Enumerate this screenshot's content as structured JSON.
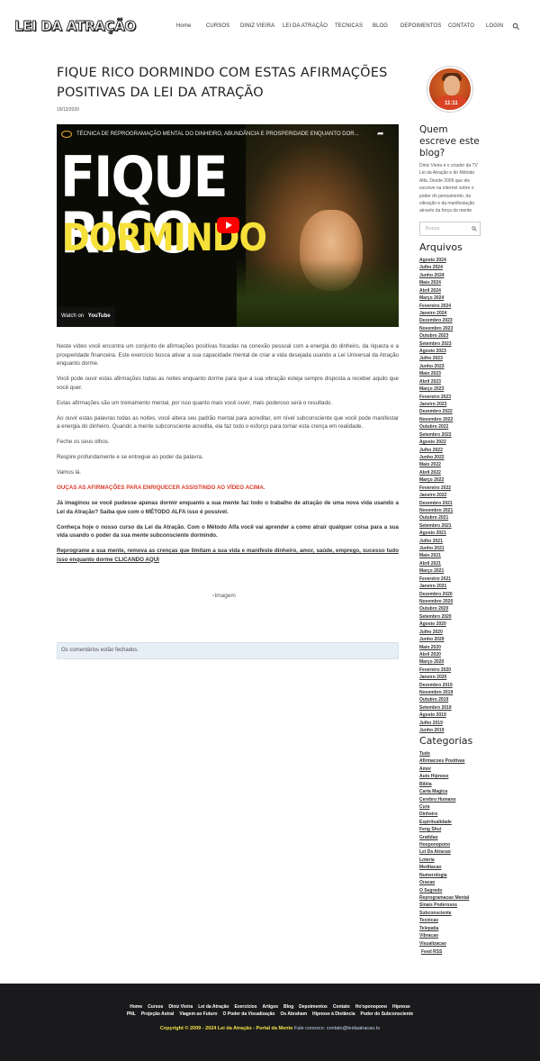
{
  "header": {
    "logo": "LEI DA ATRAÇÃO",
    "nav": [
      "Home",
      "CURSOS",
      "DINIZ VIEIRA",
      "LEI DA ATRAÇÃO",
      "TECNICAS",
      "BLOG",
      "DEPOIMENTOS",
      "CONTATO",
      "LOGIN"
    ]
  },
  "post": {
    "title_line1": "FIQUE RICO DORMINDO COM ESTAS AFIRMAÇÕES",
    "title_line2": "POSITIVAS DA LEI DA ATRAÇÃO",
    "date": "19/12/2020",
    "video": {
      "title": "TÉCNICA DE REPROGRAMAÇÃO MENTAL DO DINHEIRO, ABUNDÂNCIA E PROSPERIDADE ENQUANTO DOR...",
      "thumb_line1": "FIQUE RICO",
      "thumb_line2": "DORMINDO",
      "watch_on": "Watch on",
      "youtube": "YouTube"
    },
    "paragraphs": [
      "Neste vídeo você encontra um conjunto de afirmações positivas focadas na conexão pessoal com a energia do dinheiro, da riqueza e a prosperidade financeira. Este exercício busca ativar a sua capacidade mental de criar a vida desejada usando a Lei Universal da Atração enquanto dorme.",
      "Você pode ouvir estas afirmações todas as noites enquanto dorme para que a sua vibração esteja sempre disposta a receber aquilo que você quer.",
      "Estas afirmações são um treinamento mental, por isso quanto mais você ouvir, mais poderoso será o resultado.",
      "Ao ouvir estas palavras todas as noites, você altera seu padrão mental para acreditar, em nível subconsciente que você pode manifestar a energia do dinheiro. Quando a mente subconsciente acredita, ela faz todo o esforço para tornar esta crença em realidade.",
      "Feche os seus olhos.",
      "Respire profundamente e se entregue ao poder da palavra.",
      "Vamos lá."
    ],
    "red_line": "OUÇAS AS AFIRMAÇÕES PARA ENRIQUECER ASSISTINDO AO VÍDEO ACIMA.",
    "bold1": "Já imaginou se você pudesse apenas dormir enquanto a sua mente faz todo o trabalho de atração de uma nova vida usando a Lei da Atração? Saiba que com o MÉTODO ALFA isso é possível.",
    "bold2": "Conheça hoje o nosso curso da Lei da Atração. Com o Método Alfa você vai aprender a como atrair qualquer coisa para a sua vida usando o poder da sua mente subconsciente dormindo.",
    "link": "Reprograme a sua mente, remova as crenças que limitam a sua vida e manifeste dinheiro, amor, saúde, emprego, sucesso tudo isso enquanto dorme CLICANDO AQUI",
    "image_alt": "Imagem",
    "comments_closed": "Os comentários estão fechados."
  },
  "sidebar": {
    "avatar_text": "11:11",
    "about_title": "Quem escreve este blog?",
    "about_text": "Diniz Vieira é o criador da TV Lei da Atração e do Método Alfa. Desde 2009 que ele escreve na internet sobre o poder do pensamento, da vibração e da manifestação através da força da mente.",
    "search_placeholder": "Busca",
    "archives_title": "Arquivos",
    "archives": [
      "Agosto 2024",
      "Julho 2024",
      "Junho 2024",
      "Maio 2024",
      "Abril 2024",
      "Março 2024",
      "Fevereiro 2024",
      "Janeiro 2024",
      "Dezembro 2023",
      "Novembro 2023",
      "Outubro 2023",
      "Setembro 2023",
      "Agosto 2023",
      "Julho 2023",
      "Junho 2023",
      "Maio 2023",
      "Abril 2023",
      "Março 2023",
      "Fevereiro 2023",
      "Janeiro 2023",
      "Dezembro 2022",
      "Novembro 2022",
      "Outubro 2022",
      "Setembro 2022",
      "Agosto 2022",
      "Julho 2022",
      "Junho 2022",
      "Maio 2022",
      "Abril 2022",
      "Março 2022",
      "Fevereiro 2022",
      "Janeiro 2022",
      "Dezembro 2021",
      "Novembro 2021",
      "Outubro 2021",
      "Setembro 2021",
      "Agosto 2021",
      "Julho 2021",
      "Junho 2021",
      "Maio 2021",
      "Abril 2021",
      "Março 2021",
      "Fevereiro 2021",
      "Janeiro 2021",
      "Dezembro 2020",
      "Novembro 2020",
      "Outubro 2020",
      "Setembro 2020",
      "Agosto 2020",
      "Julho 2020",
      "Junho 2020",
      "Maio 2020",
      "Abril 2020",
      "Março 2020",
      "Fevereiro 2020",
      "Janeiro 2020",
      "Dezembro 2019",
      "Novembro 2019",
      "Outubro 2019",
      "Setembro 2019",
      "Agosto 2019",
      "Julho 2019",
      "Junho 2019"
    ],
    "categories_title": "Categorias",
    "categories": [
      "Tudo",
      "Afirmacoes Positivas",
      "Amor",
      "Auto Hipnose",
      "Biblia",
      "Carta Magica",
      "Cerebro Humano",
      "Cura",
      "Dinheiro",
      "Espiritualidade",
      "Feng Shui",
      "Gratidao",
      "Hooponopono",
      "Lei Da Atracao",
      "Loteria",
      "Meditacao",
      "Numerologia",
      "Oracao",
      "O Segredo",
      "Reprogramacao Mental",
      "Sinais Poderosos",
      "Subconsciente",
      "Tecnicas",
      "Telepatia",
      "Vibracao",
      "Visualizacao"
    ],
    "rss": "Feed RSS"
  },
  "footer": {
    "row1": [
      "Home",
      "Cursos",
      "Diniz Vieira",
      "Lei da Atração",
      "Exercícios",
      "Artigos",
      "Blog",
      "Depoimentos",
      "Contato",
      "Ho'oponopono",
      "Hipnose"
    ],
    "row2": [
      "PNL",
      "Projeção Astral",
      "Viagem ao Futuro",
      "O Poder da Visualização",
      "Os Abraham",
      "Hipnose à Distância",
      "Poder do Subconsciente"
    ],
    "copyright": "Copyright © 2009 - 2024 Lei da Atração - Portal da Mente",
    "contact": " Fale conosco: contato@leidaatracao.tv"
  }
}
